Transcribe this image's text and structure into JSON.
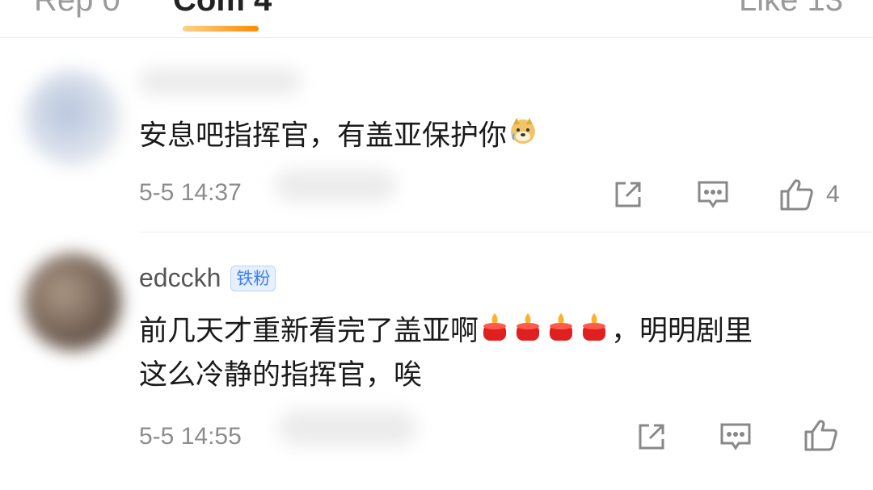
{
  "tabs": [
    {
      "label": "Rep 0"
    },
    {
      "label": "Com 4"
    },
    {
      "label": "Like 13"
    }
  ],
  "comments": [
    {
      "username": "",
      "text": "安息吧指挥官，有盖亚保护你",
      "emoji": "doge",
      "time": "5-5 14:37",
      "likes": "4"
    },
    {
      "username": "edcckh",
      "badge": "铁粉",
      "text_line1": "前几天才重新看完了盖亚啊",
      "text_after_emoji": "，明明剧里",
      "text_line2": "这么冷静的指挥官，唉",
      "emoji": "candle",
      "emoji_count": 4,
      "time": "5-5 14:55",
      "likes": ""
    }
  ],
  "icons": {
    "share": "share-icon",
    "comment": "comment-icon",
    "like": "thumbs-up-icon"
  },
  "colors": {
    "accent": "#ff8a00",
    "badge": "#3d7ef5",
    "meta": "#8c8c8c",
    "icon": "#888888"
  }
}
